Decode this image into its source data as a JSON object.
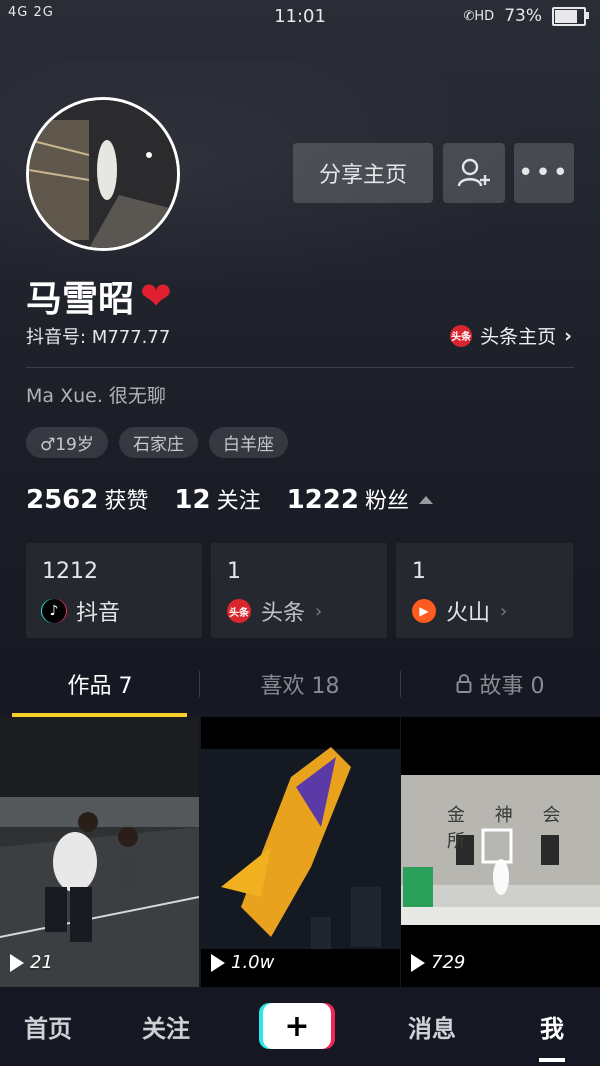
{
  "status_bar": {
    "signal": "4G 2G",
    "time": "11:01",
    "hd": "HD",
    "battery": "73%",
    "battery_level": 0.73
  },
  "profile": {
    "name": "马雪昭",
    "heart": "❤",
    "douyin_id_label": "抖音号: M777.77",
    "toutiao_badge": "头条",
    "toutiao_link": "头条主页",
    "bio": "Ma  Xue. 很无聊",
    "tags": [
      "♂19岁",
      "石家庄",
      "白羊座"
    ]
  },
  "buttons": {
    "share": "分享主页",
    "more": "•••"
  },
  "stats": [
    {
      "num": "2562",
      "label": "获赞"
    },
    {
      "num": "12",
      "label": "关注"
    },
    {
      "num": "1222",
      "label": "粉丝"
    }
  ],
  "platforms": [
    {
      "count": "1212",
      "name": "抖音",
      "badge": "♪"
    },
    {
      "count": "1",
      "name": "头条",
      "badge": "头条"
    },
    {
      "count": "1",
      "name": "火山",
      "badge": "▶"
    }
  ],
  "tabs": [
    {
      "label": "作品 7"
    },
    {
      "label": "喜欢 18"
    },
    {
      "label": "故事 0"
    }
  ],
  "videos": [
    {
      "plays": "21"
    },
    {
      "plays": "1.0w"
    },
    {
      "plays": "729"
    }
  ],
  "video3_sign": "金 神 会 所",
  "nav": {
    "home": "首页",
    "follow": "关注",
    "plus": "+",
    "messages": "消息",
    "me": "我"
  }
}
